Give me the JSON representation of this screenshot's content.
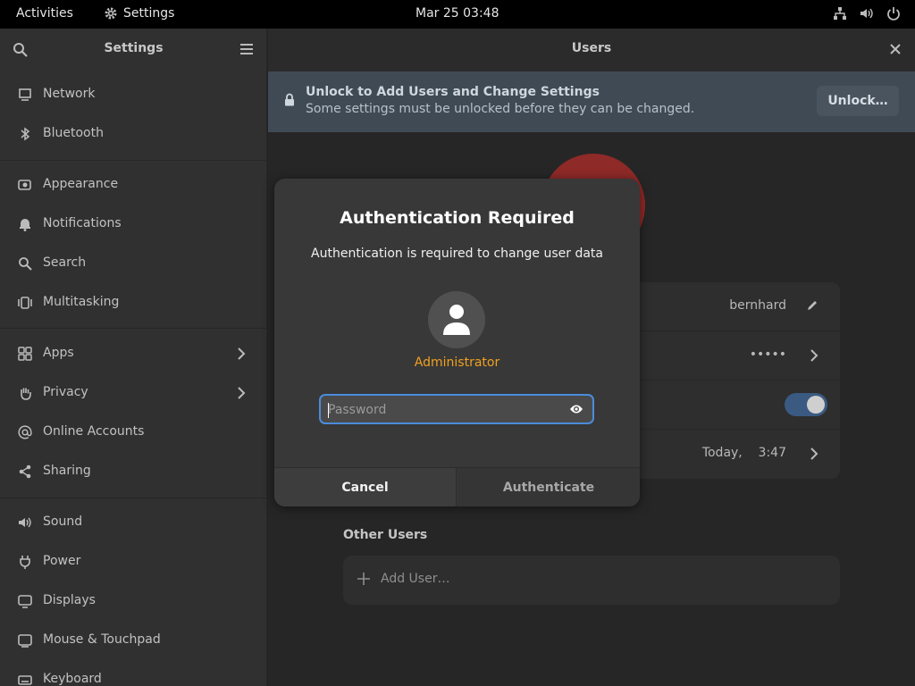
{
  "topbar": {
    "activities": "Activities",
    "app_name": "Settings",
    "clock": "Mar 25  03:48",
    "tray_icons": [
      "network-icon",
      "volume-icon",
      "power-icon"
    ]
  },
  "sidebar": {
    "title": "Settings",
    "items": [
      {
        "label": "Network",
        "icon": "network-icon"
      },
      {
        "label": "Bluetooth",
        "icon": "bluetooth-icon"
      },
      {
        "label": "Appearance",
        "icon": "appearance-icon"
      },
      {
        "label": "Notifications",
        "icon": "bell-icon"
      },
      {
        "label": "Search",
        "icon": "search-icon"
      },
      {
        "label": "Multitasking",
        "icon": "multitasking-icon"
      },
      {
        "label": "Apps",
        "icon": "apps-icon"
      },
      {
        "label": "Privacy",
        "icon": "hand-icon"
      },
      {
        "label": "Online Accounts",
        "icon": "at-icon"
      },
      {
        "label": "Sharing",
        "icon": "share-icon"
      },
      {
        "label": "Sound",
        "icon": "speaker-icon"
      },
      {
        "label": "Power",
        "icon": "power-plug-icon"
      },
      {
        "label": "Displays",
        "icon": "display-icon"
      },
      {
        "label": "Mouse & Touchpad",
        "icon": "mouse-icon"
      },
      {
        "label": "Keyboard",
        "icon": "keyboard-icon"
      }
    ]
  },
  "main": {
    "title": "Users",
    "banner": {
      "title": "Unlock to Add Users and Change Settings",
      "subtitle": "Some settings must be unlocked before they can be changed.",
      "button": "Unlock…"
    },
    "user_rows": {
      "name": "bernhard",
      "password": "•••••",
      "auto_login": true,
      "last_login": "Today,    3:47"
    },
    "other_users_title": "Other Users",
    "add_user_label": "Add User…"
  },
  "dialog": {
    "title": "Authentication Required",
    "description": "Authentication is required to change user data",
    "user": "Administrator",
    "password_placeholder": "Password",
    "cancel": "Cancel",
    "authenticate": "Authenticate"
  },
  "colors": {
    "accent": "#4a8cdc",
    "user_name": "#f0a020",
    "banner_bg": "#3f4a55",
    "dialog_bg": "#383838"
  }
}
